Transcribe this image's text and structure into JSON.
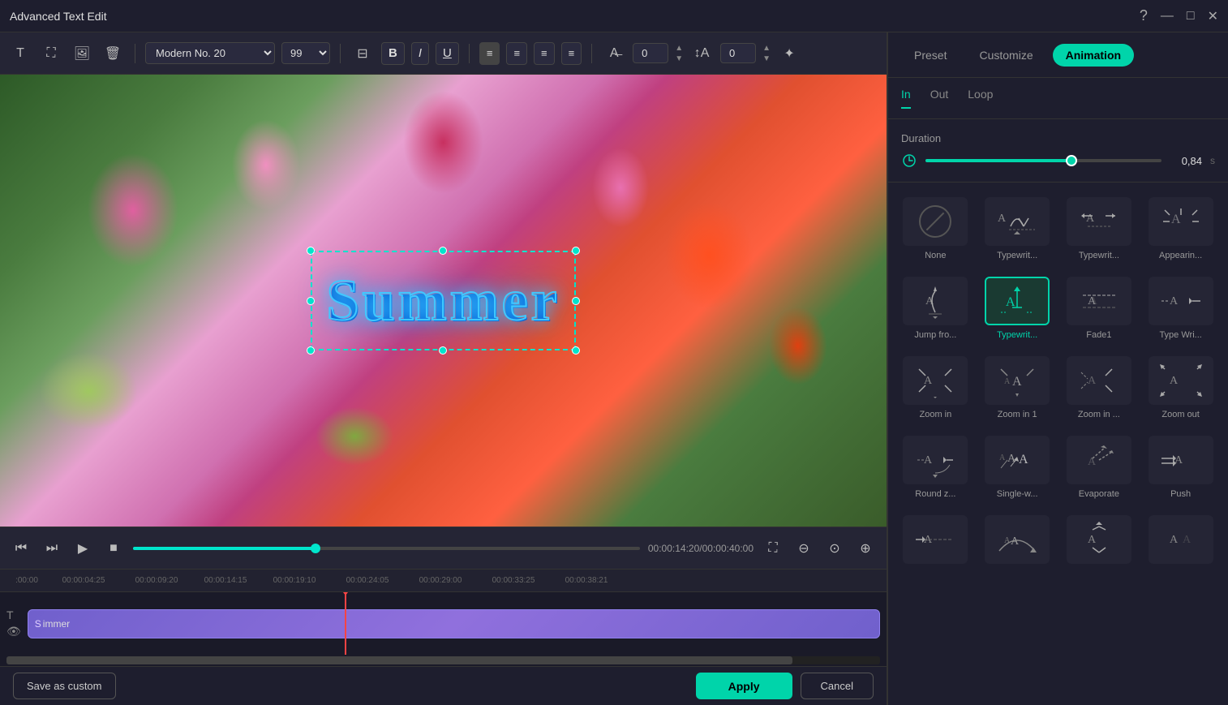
{
  "window": {
    "title": "Advanced Text Edit",
    "controls": {
      "help": "?",
      "minimize": "—",
      "maximize": "□",
      "close": "✕"
    }
  },
  "toolbar": {
    "font_name": "Modern No. 20",
    "font_size": "99",
    "bold_label": "B",
    "italic_label": "I",
    "underline_label": "U",
    "align_left": "≡",
    "align_center": "≡",
    "align_right": "≡",
    "align_justify": "≡",
    "spacing_value": "0",
    "line_height_value": "0"
  },
  "canvas": {
    "text": "Summer"
  },
  "video_controls": {
    "time_current": "00:00:14:20",
    "time_total": "00:00:40:00",
    "time_display": "00:00:14:20/00:00:40:00"
  },
  "timeline": {
    "ruler_marks": [
      ":00:00",
      "00:00:04:25",
      "00:00:09:20",
      "00:00:14:15",
      "00:00:19:10",
      "00:00:24:05",
      "00:00:29:00",
      "00:00:33:25",
      "00:00:38:21"
    ],
    "clip_label": "Summer"
  },
  "right_panel": {
    "tabs": [
      {
        "id": "preset",
        "label": "Preset"
      },
      {
        "id": "customize",
        "label": "Customize"
      },
      {
        "id": "animation",
        "label": "Animation",
        "active": true
      }
    ],
    "sub_tabs": [
      {
        "id": "in",
        "label": "In",
        "active": true
      },
      {
        "id": "out",
        "label": "Out"
      },
      {
        "id": "loop",
        "label": "Loop"
      }
    ],
    "duration": {
      "label": "Duration",
      "value": "0,84",
      "unit": "s",
      "progress": 62
    },
    "animations": [
      {
        "id": "none",
        "label": "None",
        "selected": false,
        "type": "none"
      },
      {
        "id": "typewrite1",
        "label": "Typewrit...",
        "selected": false,
        "type": "typewrite"
      },
      {
        "id": "typewrite2",
        "label": "Typewrit...",
        "selected": false,
        "type": "typewrite2"
      },
      {
        "id": "appearing",
        "label": "Appearin...",
        "selected": false,
        "type": "appearing"
      },
      {
        "id": "jumpfrom",
        "label": "Jump fro...",
        "selected": false,
        "type": "jumpfrom"
      },
      {
        "id": "typewrite3",
        "label": "Typewrit...",
        "selected": true,
        "type": "typewrite3"
      },
      {
        "id": "fade1",
        "label": "Fade1",
        "selected": false,
        "type": "fade1"
      },
      {
        "id": "typewrite4",
        "label": "Type Wri...",
        "selected": false,
        "type": "typewrite4"
      },
      {
        "id": "zoomin",
        "label": "Zoom in",
        "selected": false,
        "type": "zoomin"
      },
      {
        "id": "zoomin1",
        "label": "Zoom in 1",
        "selected": false,
        "type": "zoomin1"
      },
      {
        "id": "zoominmore",
        "label": "Zoom in ...",
        "selected": false,
        "type": "zoominmore"
      },
      {
        "id": "zoomout",
        "label": "Zoom out",
        "selected": false,
        "type": "zoomout"
      },
      {
        "id": "roundz",
        "label": "Round z...",
        "selected": false,
        "type": "roundz"
      },
      {
        "id": "singlew",
        "label": "Single-w...",
        "selected": false,
        "type": "singlew"
      },
      {
        "id": "evaporate",
        "label": "Evaporate",
        "selected": false,
        "type": "evaporate"
      },
      {
        "id": "push",
        "label": "Push",
        "selected": false,
        "type": "push"
      },
      {
        "id": "anim17",
        "label": "",
        "selected": false,
        "type": "anim17"
      },
      {
        "id": "anim18",
        "label": "",
        "selected": false,
        "type": "anim18"
      },
      {
        "id": "anim19",
        "label": "",
        "selected": false,
        "type": "anim19"
      },
      {
        "id": "anim20",
        "label": "",
        "selected": false,
        "type": "anim20"
      }
    ]
  },
  "bottom": {
    "save_as_custom": "Save as custom",
    "apply": "Apply",
    "cancel": "Cancel"
  }
}
